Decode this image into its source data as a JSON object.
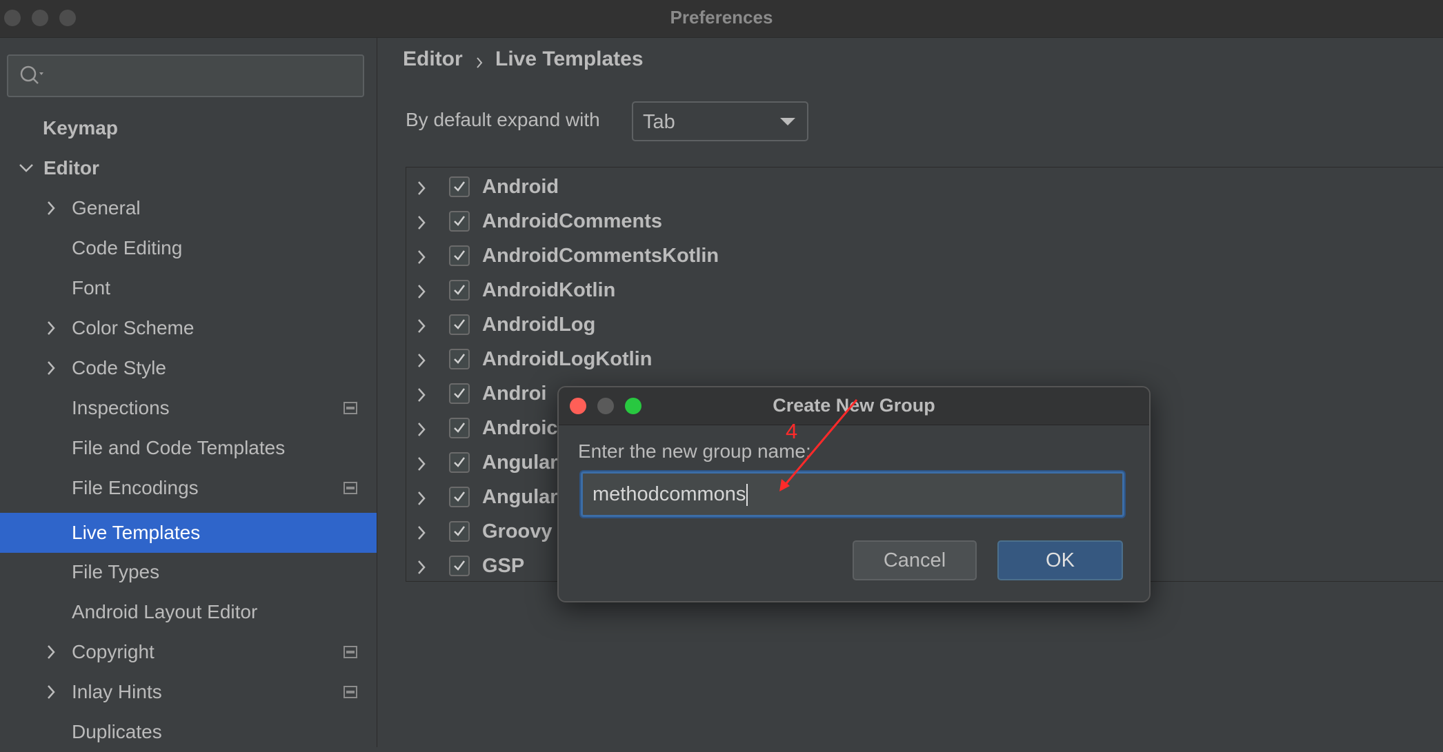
{
  "window": {
    "title": "Preferences"
  },
  "sidebar": {
    "search_placeholder": "",
    "items": [
      {
        "label": "Keymap"
      },
      {
        "label": "Editor"
      },
      {
        "label": "General"
      },
      {
        "label": "Code Editing"
      },
      {
        "label": "Font"
      },
      {
        "label": "Color Scheme"
      },
      {
        "label": "Code Style"
      },
      {
        "label": "Inspections"
      },
      {
        "label": "File and Code Templates"
      },
      {
        "label": "File Encodings"
      },
      {
        "label": "Live Templates"
      },
      {
        "label": "File Types"
      },
      {
        "label": "Android Layout Editor"
      },
      {
        "label": "Copyright"
      },
      {
        "label": "Inlay Hints"
      },
      {
        "label": "Duplicates"
      }
    ],
    "selected": "Live Templates"
  },
  "main": {
    "breadcrumb": [
      "Editor",
      "Live Templates"
    ],
    "expand_label": "By default expand with",
    "expand_value": "Tab",
    "template_groups": [
      {
        "label": "Android",
        "checked": true
      },
      {
        "label": "AndroidComments",
        "checked": true
      },
      {
        "label": "AndroidCommentsKotlin",
        "checked": true
      },
      {
        "label": "AndroidKotlin",
        "checked": true
      },
      {
        "label": "AndroidLog",
        "checked": true
      },
      {
        "label": "AndroidLogKotlin",
        "checked": true
      },
      {
        "label": "Androi",
        "checked": true
      },
      {
        "label": "Androic",
        "checked": true
      },
      {
        "label": "Angular",
        "checked": true
      },
      {
        "label": "Angular",
        "checked": true
      },
      {
        "label": "Groovy",
        "checked": true
      },
      {
        "label": "GSP",
        "checked": true
      }
    ]
  },
  "dialog": {
    "title": "Create New Group",
    "prompt": "Enter the new group name:",
    "input_value": "methodcommons",
    "cancel_label": "Cancel",
    "ok_label": "OK"
  },
  "annotation": {
    "label": "4",
    "color": "#ff2a2a"
  },
  "colors": {
    "selection": "#2f65ca",
    "background": "#3c3f41",
    "accent_focus": "#3c6da6"
  }
}
